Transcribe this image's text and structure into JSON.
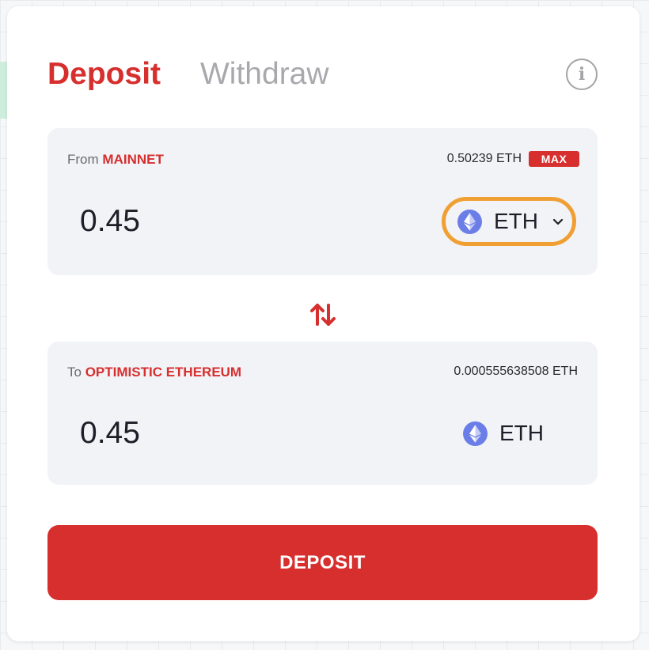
{
  "tabs": {
    "deposit": "Deposit",
    "withdraw": "Withdraw"
  },
  "info_icon": "info-circle-icon",
  "from": {
    "prefix": "From",
    "network": "MAINNET",
    "balance": "0.50239 ETH",
    "max_label": "MAX",
    "amount": "0.45",
    "token": "ETH",
    "token_icon": "ethereum-icon"
  },
  "swap_icon": "swap-vertical-arrows-icon",
  "to": {
    "prefix": "To",
    "network": "OPTIMISTIC ETHEREUM",
    "balance": "0.000555638508 ETH",
    "amount": "0.45",
    "token": "ETH",
    "token_icon": "ethereum-icon"
  },
  "action": {
    "deposit_label": "DEPOSIT"
  },
  "colors": {
    "accent": "#d72e2e",
    "muted": "#a9a9ad",
    "panel_bg": "#f2f3f7",
    "focus_ring": "#f0a033",
    "eth": "#6b7ee8"
  }
}
